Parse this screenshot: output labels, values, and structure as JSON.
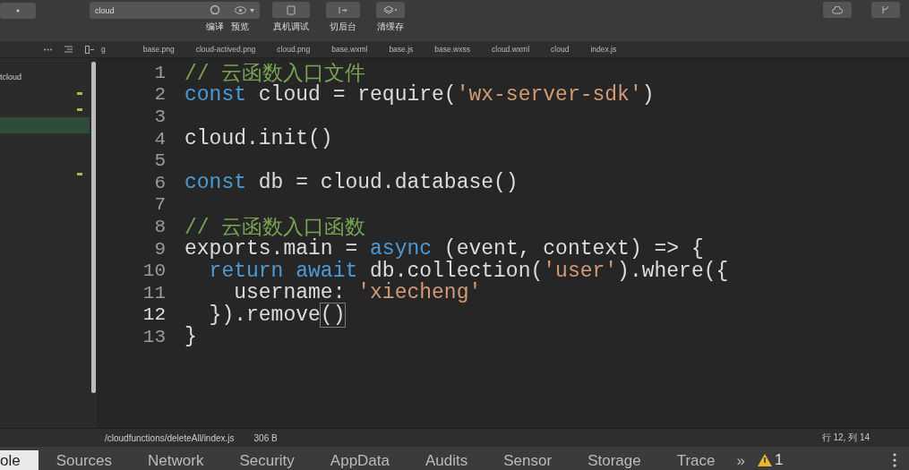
{
  "toolbar": {
    "project": "cloud",
    "tools": [
      {
        "kind": "compile",
        "label": "编译"
      },
      {
        "kind": "preview",
        "label": "预览"
      },
      {
        "kind": "device",
        "label": "真机调试"
      },
      {
        "kind": "background",
        "label": "切后台"
      },
      {
        "kind": "cache",
        "label": "清缓存"
      }
    ]
  },
  "file_tabs": [
    "g",
    "base.png",
    "cloud-actived.png",
    "cloud.png",
    "base.wxml",
    "base.js",
    "base.wxss",
    "cloud.wxml",
    "cloud",
    "index.js"
  ],
  "sidebar": {
    "items": [
      {
        "label": "tcloud",
        "selected": false,
        "modified": false
      },
      {
        "selected": false,
        "modified": true
      },
      {
        "selected": false,
        "modified": true
      },
      {
        "selected": true,
        "modified": false
      },
      {
        "selected": false,
        "modified": true
      }
    ]
  },
  "editor": {
    "lines": [
      {
        "number": "1",
        "current": false,
        "tokens": [
          {
            "kind": "comment",
            "text": "// 云函数入口文件"
          }
        ]
      },
      {
        "number": "2",
        "current": false,
        "tokens": [
          {
            "kind": "keyword",
            "text": "const"
          },
          {
            "kind": "plain",
            "text": " cloud = require("
          },
          {
            "kind": "string",
            "text": "'wx-server-sdk'"
          },
          {
            "kind": "plain",
            "text": ")"
          }
        ]
      },
      {
        "number": "3",
        "current": false
      },
      {
        "number": "4",
        "current": false,
        "tokens": [
          {
            "kind": "plain",
            "text": "cloud.init()"
          }
        ]
      },
      {
        "number": "5",
        "current": false
      },
      {
        "number": "6",
        "current": false,
        "tokens": [
          {
            "kind": "keyword",
            "text": "const"
          },
          {
            "kind": "plain",
            "text": " db = cloud.database()"
          }
        ]
      },
      {
        "number": "7",
        "current": false
      },
      {
        "number": "8",
        "current": false,
        "tokens": [
          {
            "kind": "comment",
            "text": "// 云函数入口函数"
          }
        ]
      },
      {
        "number": "9",
        "current": false,
        "tokens": [
          {
            "kind": "plain",
            "text": "exports.main = "
          },
          {
            "kind": "keyword",
            "text": "async"
          },
          {
            "kind": "plain",
            "text": " (event, context) => {"
          }
        ]
      },
      {
        "number": "10",
        "current": false,
        "tokens": [
          {
            "kind": "keyword",
            "text": "  return await"
          },
          {
            "kind": "plain",
            "text": " db.collection("
          },
          {
            "kind": "string",
            "text": "'user'"
          },
          {
            "kind": "plain",
            "text": ").where({"
          }
        ]
      },
      {
        "number": "11",
        "current": false,
        "tokens": [
          {
            "kind": "plain",
            "text": "    username: "
          },
          {
            "kind": "string",
            "text": "'xiecheng'"
          }
        ]
      },
      {
        "number": "12",
        "current": true,
        "tokens": [
          {
            "kind": "plain",
            "text": "  }).remove"
          },
          {
            "kind": "match",
            "text": "()"
          }
        ]
      },
      {
        "number": "13",
        "current": false,
        "tokens": [
          {
            "kind": "plain",
            "text": "}"
          }
        ]
      }
    ]
  },
  "status_bar": {
    "path": "/cloudfunctions/deleteAll/index.js",
    "size": "306 B",
    "position": "行 12, 列 14"
  },
  "devtools_tabs": [
    {
      "label": "ole",
      "selected": true
    },
    {
      "label": "Sources",
      "selected": false
    },
    {
      "label": "Network",
      "selected": false
    },
    {
      "label": "Security",
      "selected": false
    },
    {
      "label": "AppData",
      "selected": false
    },
    {
      "label": "Audits",
      "selected": false
    },
    {
      "label": "Sensor",
      "selected": false
    },
    {
      "label": "Storage",
      "selected": false
    },
    {
      "label": "Trace",
      "selected": false
    }
  ],
  "devtools_more": "»",
  "warnings": "1"
}
